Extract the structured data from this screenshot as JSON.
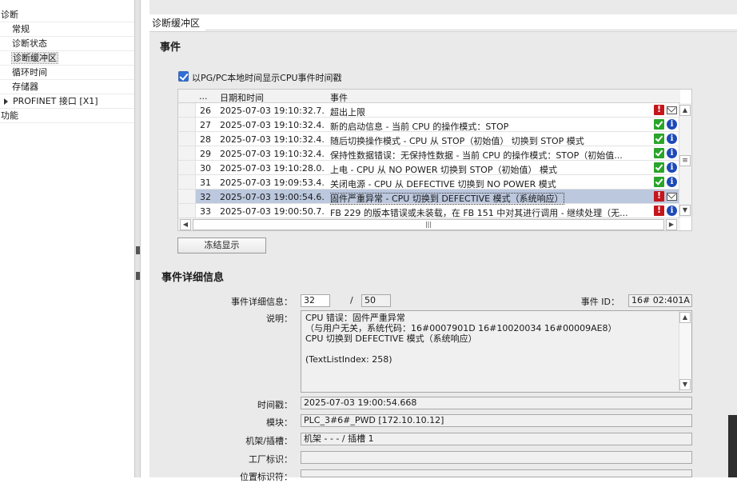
{
  "tree": {
    "items": [
      {
        "label": "诊断",
        "level": 0
      },
      {
        "label": "常规",
        "level": 1
      },
      {
        "label": "诊断状态",
        "level": 1
      },
      {
        "label": "诊断缓冲区",
        "level": 1,
        "selected": true
      },
      {
        "label": "循环时间",
        "level": 1
      },
      {
        "label": "存储器",
        "level": 1
      },
      {
        "label": "PROFINET 接口 [X1]",
        "level": 0,
        "expandable": true
      },
      {
        "label": "功能",
        "level": 0
      }
    ]
  },
  "panel": {
    "title": "诊断缓冲区",
    "events_title": "事件",
    "checkbox_label": "以PG/PC本地时间显示CPU事件时间戳",
    "checkbox_checked": true,
    "columns": {
      "idx": "...",
      "datetime": "日期和时间",
      "event": "事件"
    },
    "rows": [
      {
        "no": "26",
        "datetime": "2025-07-03 19:10:32.7...",
        "event": "超出上限",
        "status": "error",
        "icon2": "mail"
      },
      {
        "no": "27",
        "datetime": "2025-07-03 19:10:32.4...",
        "event": "新的启动信息 - 当前 CPU 的操作模式：STOP",
        "status": "ok",
        "icon2": "info"
      },
      {
        "no": "28",
        "datetime": "2025-07-03 19:10:32.4...",
        "event": "随后切换操作模式 - CPU 从 STOP（初始值） 切换到 STOP 模式",
        "status": "ok",
        "icon2": "info"
      },
      {
        "no": "29",
        "datetime": "2025-07-03 19:10:32.4...",
        "event": "保持性数据错误：无保持性数据 - 当前 CPU 的操作模式：STOP（初始值...",
        "status": "ok",
        "icon2": "info"
      },
      {
        "no": "30",
        "datetime": "2025-07-03 19:10:28.0...",
        "event": "上电 - CPU 从 NO POWER 切换到 STOP（初始值） 模式",
        "status": "ok",
        "icon2": "info"
      },
      {
        "no": "31",
        "datetime": "2025-07-03 19:09:53.4...",
        "event": "关闭电源 - CPU 从 DEFECTIVE 切换到 NO POWER 模式",
        "status": "ok",
        "icon2": "info"
      },
      {
        "no": "32",
        "datetime": "2025-07-03 19:00:54.6...",
        "event": "固件严重异常 - CPU 切换到 DEFECTIVE 模式（系统响应）",
        "status": "error",
        "icon2": "mail",
        "selected": true
      },
      {
        "no": "33",
        "datetime": "2025-07-03 19:00:50.7...",
        "event": "FB 229 的版本错误或未装载，在 FB 151 中对其进行调用 - 继续处理（无...",
        "status": "error",
        "icon2": "info"
      }
    ],
    "freeze_button": "冻结显示",
    "details_title": "事件详细信息",
    "details": {
      "detail_label": "事件详细信息：",
      "detail_current": "32",
      "detail_sep": "/",
      "detail_total": "50",
      "event_id_label": "事件 ID：",
      "event_id": "16# 02:401A",
      "desc_label": "说明：",
      "desc_lines": [
        "CPU 错误：固件严重异常",
        "（与用户无关，系统代码：16#0007901D 16#10020034 16#00009AE8）",
        "CPU 切换到 DEFECTIVE 模式（系统响应）",
        "",
        "(TextListIndex: 258)"
      ],
      "timestamp_label": "时间戳：",
      "timestamp": "2025-07-03 19:00:54.668",
      "module_label": "模块：",
      "module": "PLC_3#6#_PWD [172.10.10.12]",
      "rack_label": "机架/插槽：",
      "rack": "机架 - - - / 插槽 1",
      "plant_label": "工厂标识：",
      "plant": "",
      "location_label": "位置标识符："
    }
  },
  "colors": {
    "selected_row": "#bcc8de",
    "ok_icon": "#2aa42a",
    "error_icon": "#c4161c",
    "info_icon": "#1e49b8",
    "panel_bg": "#eaeaea"
  }
}
